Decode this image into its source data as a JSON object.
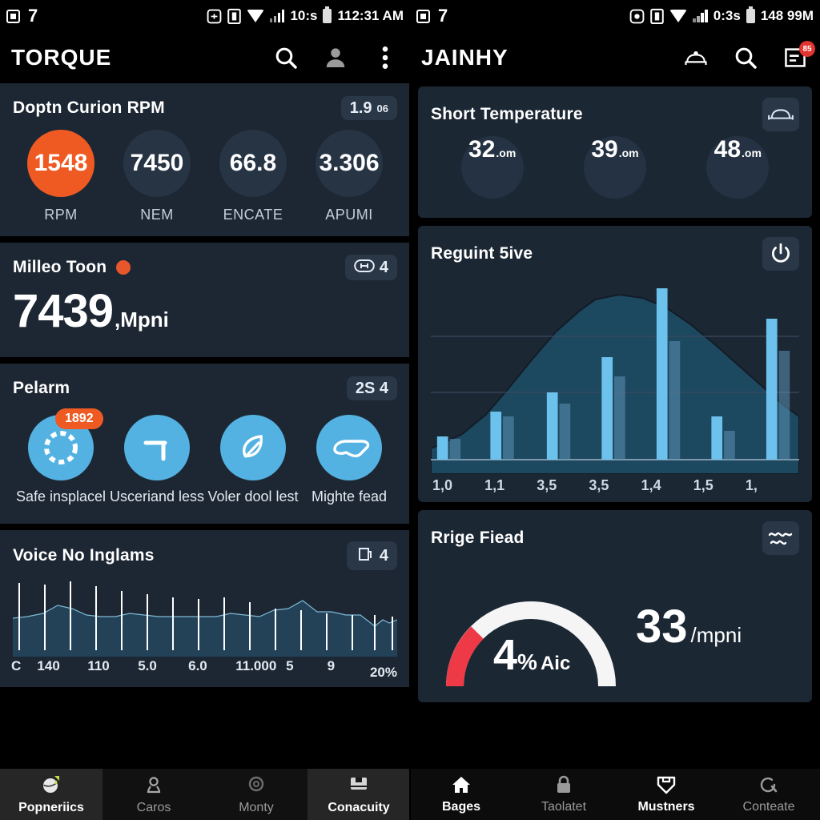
{
  "left": {
    "statusbar": {
      "notif_count": "7",
      "network": "10:s",
      "clock": "112:31 AM"
    },
    "appbar": {
      "title": "TORQUE",
      "icons": [
        "search-icon",
        "account-icon",
        "overflow-menu-icon"
      ]
    },
    "cards": [
      {
        "title": "Doptn Curion RPM",
        "badge": "1.9",
        "badge_sup": "06",
        "gauges": [
          {
            "value": "1548",
            "label": "RPM",
            "active": true
          },
          {
            "value": "7450",
            "label": "NEM",
            "active": false
          },
          {
            "value": "66.8",
            "label": "ENCATE",
            "active": false
          },
          {
            "value": "3.306",
            "label": "APUMI",
            "active": false
          }
        ]
      },
      {
        "title": "Milleo Toon",
        "badge": "4",
        "badge_icon": "speed-tag-icon",
        "value": "7439",
        "unit": ",Mpni"
      },
      {
        "title": "Pelarm",
        "badge": "2S 4",
        "actions": [
          {
            "caption": "Safe insplacel",
            "pill": "1892",
            "icon": "dashed-circle-icon"
          },
          {
            "caption": "Usceriand less",
            "pill": "",
            "icon": "t-junction-icon"
          },
          {
            "caption": "Voler dool lest",
            "pill": "",
            "icon": "leaf-pen-icon"
          },
          {
            "caption": "Mighte fead",
            "pill": "",
            "icon": "goggles-icon"
          }
        ]
      },
      {
        "title": "Voice No Inglams",
        "badge": "4",
        "badge_icon": "fuel-tank-icon",
        "axis": [
          "C",
          "140",
          "110",
          "5.0",
          "6.0",
          "11.000",
          "5",
          "9",
          "20%"
        ]
      }
    ],
    "nav": [
      {
        "label": "Popneriics",
        "icon": "globe-upload-icon",
        "active": true
      },
      {
        "label": "Caros",
        "icon": "location-pin-icon",
        "active": false
      },
      {
        "label": "Monty",
        "icon": "settings-gear-icon",
        "active": false
      },
      {
        "label": "Conacuity",
        "icon": "save-disk-icon",
        "active": true
      }
    ]
  },
  "right": {
    "statusbar": {
      "notif_count": "7",
      "network": "0:3s",
      "clock": "148 99M"
    },
    "appbar": {
      "title": "JAINHY",
      "icons": [
        "car-icon",
        "search-icon",
        "list-icon"
      ],
      "badge": "85"
    },
    "cards": [
      {
        "title": "Short Temperature",
        "icon": "car-outline-icon",
        "circles": [
          {
            "value": "32",
            "unit": ".om"
          },
          {
            "value": "39",
            "unit": ".om"
          },
          {
            "value": "48",
            "unit": ".om"
          }
        ]
      },
      {
        "title": "Reguint 5ive",
        "icon": "power-icon"
      },
      {
        "title": "Rrige Fiead",
        "icon": "wave-check-icon",
        "gauge_value": "4",
        "gauge_percent": "%",
        "gauge_suffix": "Aic",
        "side_value": "33",
        "side_unit": "/mpni"
      }
    ],
    "nav": [
      {
        "label": "Bages",
        "icon": "home-icon",
        "active": true
      },
      {
        "label": "Taolatet",
        "icon": "lock-icon",
        "active": false
      },
      {
        "label": "Mustners",
        "icon": "download-shield-icon",
        "active": true
      },
      {
        "label": "Conteate",
        "icon": "search-circle-icon",
        "active": false
      }
    ]
  },
  "chart_data": [
    {
      "type": "area",
      "title": "Voice No Inglams",
      "x": [
        "C",
        "140",
        "110",
        "5.0",
        "6.0",
        "11.000",
        "5",
        "9",
        "20%"
      ],
      "values": [
        28,
        30,
        36,
        33,
        31,
        32,
        31,
        30,
        33,
        34,
        33,
        36,
        34,
        33,
        29,
        30,
        31
      ],
      "grid": false,
      "legend": "none",
      "ylabel": "",
      "xlabel": ""
    },
    {
      "type": "bar",
      "title": "Reguint 5ive",
      "categories": [
        "1,0",
        "1,1",
        "3,5",
        "3,5",
        "1,4",
        "1,5",
        "1,"
      ],
      "series": [
        {
          "name": "primary",
          "values": [
            12,
            28,
            40,
            67,
            100,
            30,
            78
          ]
        },
        {
          "name": "secondary",
          "values": [
            10,
            24,
            32,
            52,
            82,
            18,
            60
          ]
        }
      ],
      "overlay_area": {
        "type": "area",
        "values": [
          8,
          12,
          22,
          40,
          66,
          88,
          100,
          96,
          82,
          62
        ]
      },
      "ylim": [
        0,
        100
      ],
      "grid": true,
      "legend": "none"
    },
    {
      "type": "pie",
      "title": "Rrige Fiead",
      "subtype": "gauge-arc",
      "segments": [
        {
          "name": "warning",
          "color": "#ed3a46",
          "fraction": 0.22
        },
        {
          "name": "normal",
          "color": "#f5f5f5",
          "fraction": 0.78
        }
      ],
      "value": "4",
      "value_unit": "%Aic",
      "secondary_value": "33",
      "secondary_unit": "/mpni"
    }
  ],
  "colors": {
    "accent_orange": "#ef5a23",
    "accent_blue": "#53b2e2",
    "bar_blue": "#6cc2ec",
    "card_bg": "#1d2733",
    "screen_bg": "#000000",
    "danger_red": "#ed3a46"
  }
}
